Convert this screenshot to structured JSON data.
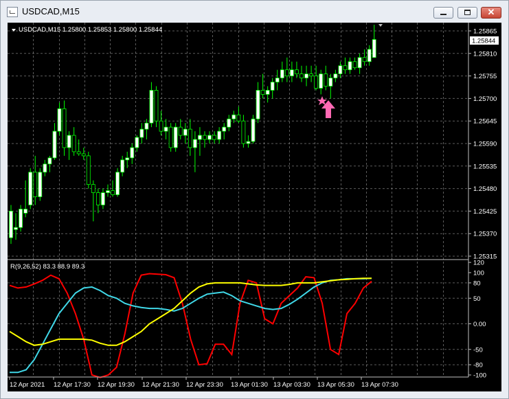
{
  "window": {
    "title": "USDCAD,M15",
    "minimize_icon": "minimize-icon",
    "maximize_icon": "maximize-icon",
    "close_icon": "close-icon"
  },
  "colors": {
    "background": "#000000",
    "grid": "#9a9a9a",
    "candle_bull": "#ffffff",
    "candle_bear": "#000000",
    "candle_outline": "#00ff00",
    "line_red": "#ff0000",
    "line_cyan": "#40d8e8",
    "line_yellow": "#ffff00",
    "price_label_bg": "#ffffff",
    "arrow": "#ff69b4"
  },
  "main": {
    "header_text": "USDCAD,M15  1.25800 1.25853 1.25800 1.25844",
    "current_price": "1.25844",
    "price_ticks": [
      "1.25865",
      "1.25810",
      "1.25755",
      "1.25700",
      "1.25645",
      "1.25590",
      "1.25535",
      "1.25480",
      "1.25425",
      "1.25370",
      "1.25315"
    ]
  },
  "indicator": {
    "header_text": "R(9,26,52) 83.3 88.9 89.3",
    "ticks": [
      "120",
      "100",
      "80",
      "50",
      "0.00",
      "-50",
      "-80",
      "-100"
    ]
  },
  "time_axis": [
    "12 Apr 2021",
    "12 Apr 17:30",
    "12 Apr 19:30",
    "12 Apr 21:30",
    "12 Apr 23:30",
    "13 Apr 01:30",
    "13 Apr 03:30",
    "13 Apr 05:30",
    "13 Apr 07:30"
  ],
  "markers": {
    "buy_arrow": "up-arrow-icon",
    "star": "star-icon"
  },
  "chart_data": [
    {
      "type": "candlestick",
      "title": "USDCAD,M15",
      "ylim": [
        1.25315,
        1.25875
      ],
      "candles": [
        {
          "o": 1.2536,
          "h": 1.2544,
          "l": 1.25345,
          "c": 1.25425
        },
        {
          "o": 1.2538,
          "h": 1.2542,
          "l": 1.25355,
          "c": 1.25385
        },
        {
          "o": 1.25385,
          "h": 1.2544,
          "l": 1.25375,
          "c": 1.2543
        },
        {
          "o": 1.2542,
          "h": 1.255,
          "l": 1.2541,
          "c": 1.2543
        },
        {
          "o": 1.2544,
          "h": 1.2553,
          "l": 1.2543,
          "c": 1.2552
        },
        {
          "o": 1.2552,
          "h": 1.2556,
          "l": 1.2544,
          "c": 1.2546
        },
        {
          "o": 1.2546,
          "h": 1.2553,
          "l": 1.2545,
          "c": 1.2552
        },
        {
          "o": 1.2552,
          "h": 1.2555,
          "l": 1.2551,
          "c": 1.2554
        },
        {
          "o": 1.2554,
          "h": 1.2556,
          "l": 1.2552,
          "c": 1.25555
        },
        {
          "o": 1.25555,
          "h": 1.2564,
          "l": 1.2555,
          "c": 1.2562
        },
        {
          "o": 1.2562,
          "h": 1.2569,
          "l": 1.2561,
          "c": 1.25675
        },
        {
          "o": 1.25675,
          "h": 1.25695,
          "l": 1.2556,
          "c": 1.2558
        },
        {
          "o": 1.2558,
          "h": 1.2562,
          "l": 1.2555,
          "c": 1.2561
        },
        {
          "o": 1.2561,
          "h": 1.2563,
          "l": 1.2556,
          "c": 1.2557
        },
        {
          "o": 1.2557,
          "h": 1.256,
          "l": 1.2556,
          "c": 1.25565
        },
        {
          "o": 1.25565,
          "h": 1.2558,
          "l": 1.2555,
          "c": 1.2556
        },
        {
          "o": 1.2556,
          "h": 1.2557,
          "l": 1.2548,
          "c": 1.2549
        },
        {
          "o": 1.2549,
          "h": 1.255,
          "l": 1.254,
          "c": 1.2547
        },
        {
          "o": 1.2547,
          "h": 1.2548,
          "l": 1.2542,
          "c": 1.2544
        },
        {
          "o": 1.2544,
          "h": 1.2548,
          "l": 1.2543,
          "c": 1.2547
        },
        {
          "o": 1.2547,
          "h": 1.2549,
          "l": 1.2546,
          "c": 1.25475
        },
        {
          "o": 1.25475,
          "h": 1.255,
          "l": 1.2546,
          "c": 1.25465
        },
        {
          "o": 1.25465,
          "h": 1.2553,
          "l": 1.2546,
          "c": 1.2552
        },
        {
          "o": 1.2552,
          "h": 1.2556,
          "l": 1.2551,
          "c": 1.2555
        },
        {
          "o": 1.2555,
          "h": 1.2557,
          "l": 1.2553,
          "c": 1.25555
        },
        {
          "o": 1.25555,
          "h": 1.2559,
          "l": 1.2554,
          "c": 1.2558
        },
        {
          "o": 1.2558,
          "h": 1.2561,
          "l": 1.2557,
          "c": 1.25605
        },
        {
          "o": 1.25605,
          "h": 1.2564,
          "l": 1.2559,
          "c": 1.25625
        },
        {
          "o": 1.25625,
          "h": 1.2565,
          "l": 1.256,
          "c": 1.2564
        },
        {
          "o": 1.2564,
          "h": 1.2574,
          "l": 1.2563,
          "c": 1.2572
        },
        {
          "o": 1.2572,
          "h": 1.2573,
          "l": 1.2563,
          "c": 1.25645
        },
        {
          "o": 1.25645,
          "h": 1.2567,
          "l": 1.2561,
          "c": 1.2562
        },
        {
          "o": 1.2562,
          "h": 1.2565,
          "l": 1.256,
          "c": 1.2563
        },
        {
          "o": 1.2563,
          "h": 1.2564,
          "l": 1.2557,
          "c": 1.2558
        },
        {
          "o": 1.2558,
          "h": 1.2564,
          "l": 1.2557,
          "c": 1.2563
        },
        {
          "o": 1.2563,
          "h": 1.2565,
          "l": 1.256,
          "c": 1.2561
        },
        {
          "o": 1.2561,
          "h": 1.2564,
          "l": 1.2559,
          "c": 1.25625
        },
        {
          "o": 1.25625,
          "h": 1.2565,
          "l": 1.2556,
          "c": 1.2558
        },
        {
          "o": 1.2558,
          "h": 1.2562,
          "l": 1.2552,
          "c": 1.256
        },
        {
          "o": 1.256,
          "h": 1.2563,
          "l": 1.2556,
          "c": 1.2561
        },
        {
          "o": 1.2561,
          "h": 1.2562,
          "l": 1.2558,
          "c": 1.256
        },
        {
          "o": 1.256,
          "h": 1.2562,
          "l": 1.2559,
          "c": 1.2561
        },
        {
          "o": 1.2561,
          "h": 1.2562,
          "l": 1.2559,
          "c": 1.256
        },
        {
          "o": 1.256,
          "h": 1.2563,
          "l": 1.2559,
          "c": 1.2562
        },
        {
          "o": 1.2562,
          "h": 1.2564,
          "l": 1.256,
          "c": 1.2563
        },
        {
          "o": 1.2563,
          "h": 1.2566,
          "l": 1.2562,
          "c": 1.2565
        },
        {
          "o": 1.2565,
          "h": 1.2567,
          "l": 1.2564,
          "c": 1.2566
        },
        {
          "o": 1.2566,
          "h": 1.2568,
          "l": 1.2564,
          "c": 1.25645
        },
        {
          "o": 1.25645,
          "h": 1.2566,
          "l": 1.2558,
          "c": 1.2559
        },
        {
          "o": 1.2559,
          "h": 1.2561,
          "l": 1.2558,
          "c": 1.25595
        },
        {
          "o": 1.25595,
          "h": 1.2566,
          "l": 1.2559,
          "c": 1.2565
        },
        {
          "o": 1.2565,
          "h": 1.2574,
          "l": 1.2564,
          "c": 1.2572
        },
        {
          "o": 1.2572,
          "h": 1.2576,
          "l": 1.257,
          "c": 1.2571
        },
        {
          "o": 1.2571,
          "h": 1.2573,
          "l": 1.2569,
          "c": 1.2572
        },
        {
          "o": 1.2572,
          "h": 1.2575,
          "l": 1.257,
          "c": 1.2574
        },
        {
          "o": 1.2574,
          "h": 1.2577,
          "l": 1.2572,
          "c": 1.2575
        },
        {
          "o": 1.2575,
          "h": 1.2579,
          "l": 1.2574,
          "c": 1.2577
        },
        {
          "o": 1.2577,
          "h": 1.258,
          "l": 1.2574,
          "c": 1.25755
        },
        {
          "o": 1.25755,
          "h": 1.2579,
          "l": 1.2574,
          "c": 1.2577
        },
        {
          "o": 1.2577,
          "h": 1.2579,
          "l": 1.2575,
          "c": 1.2576
        },
        {
          "o": 1.2576,
          "h": 1.2578,
          "l": 1.2574,
          "c": 1.2575
        },
        {
          "o": 1.2575,
          "h": 1.2578,
          "l": 1.2573,
          "c": 1.2576
        },
        {
          "o": 1.2576,
          "h": 1.2578,
          "l": 1.2574,
          "c": 1.25755
        },
        {
          "o": 1.25755,
          "h": 1.2578,
          "l": 1.2572,
          "c": 1.25725
        },
        {
          "o": 1.25725,
          "h": 1.2577,
          "l": 1.2571,
          "c": 1.2576
        },
        {
          "o": 1.2576,
          "h": 1.2578,
          "l": 1.2572,
          "c": 1.2573
        },
        {
          "o": 1.2573,
          "h": 1.2576,
          "l": 1.257,
          "c": 1.2575
        },
        {
          "o": 1.2575,
          "h": 1.2577,
          "l": 1.2574,
          "c": 1.2576
        },
        {
          "o": 1.2576,
          "h": 1.2579,
          "l": 1.2575,
          "c": 1.2578
        },
        {
          "o": 1.2578,
          "h": 1.258,
          "l": 1.2576,
          "c": 1.2577
        },
        {
          "o": 1.2577,
          "h": 1.258,
          "l": 1.2576,
          "c": 1.2579
        },
        {
          "o": 1.2579,
          "h": 1.258,
          "l": 1.2577,
          "c": 1.25775
        },
        {
          "o": 1.25775,
          "h": 1.2581,
          "l": 1.2576,
          "c": 1.258
        },
        {
          "o": 1.258,
          "h": 1.2582,
          "l": 1.2578,
          "c": 1.2579
        },
        {
          "o": 1.2579,
          "h": 1.2583,
          "l": 1.2578,
          "c": 1.2582
        },
        {
          "o": 1.258,
          "h": 1.2588,
          "l": 1.258,
          "c": 1.25844
        }
      ]
    },
    {
      "type": "line",
      "title": "R(9,26,52) 83.3 88.9 89.3",
      "ylim": [
        -100,
        120
      ],
      "series": [
        {
          "color": "#ff0000",
          "values": [
            75,
            70,
            72,
            78,
            85,
            95,
            88,
            60,
            20,
            -30,
            -100,
            -105,
            -100,
            -85,
            -20,
            60,
            95,
            98,
            97,
            96,
            90,
            40,
            -30,
            -80,
            -78,
            -40,
            -40,
            -60,
            40,
            85,
            80,
            10,
            0,
            40,
            55,
            70,
            92,
            90,
            40,
            -50,
            -60,
            20,
            40,
            70,
            83
          ]
        },
        {
          "color": "#40d8e8",
          "values": [
            -95,
            -95,
            -90,
            -70,
            -40,
            -10,
            20,
            40,
            60,
            70,
            72,
            65,
            55,
            50,
            40,
            35,
            32,
            30,
            30,
            28,
            25,
            30,
            40,
            50,
            58,
            60,
            62,
            55,
            45,
            40,
            35,
            30,
            28,
            30,
            38,
            48,
            60,
            72,
            80,
            85,
            86,
            88,
            88,
            88,
            89
          ]
        },
        {
          "color": "#ffff00",
          "values": [
            -15,
            -25,
            -35,
            -42,
            -40,
            -35,
            -30,
            -30,
            -30,
            -30,
            -32,
            -38,
            -42,
            -42,
            -35,
            -25,
            -15,
            0,
            10,
            20,
            30,
            45,
            60,
            72,
            78,
            80,
            80,
            80,
            80,
            78,
            76,
            75,
            75,
            75,
            77,
            80,
            80,
            80,
            82,
            84,
            86,
            87,
            88,
            89,
            89
          ]
        }
      ]
    }
  ]
}
